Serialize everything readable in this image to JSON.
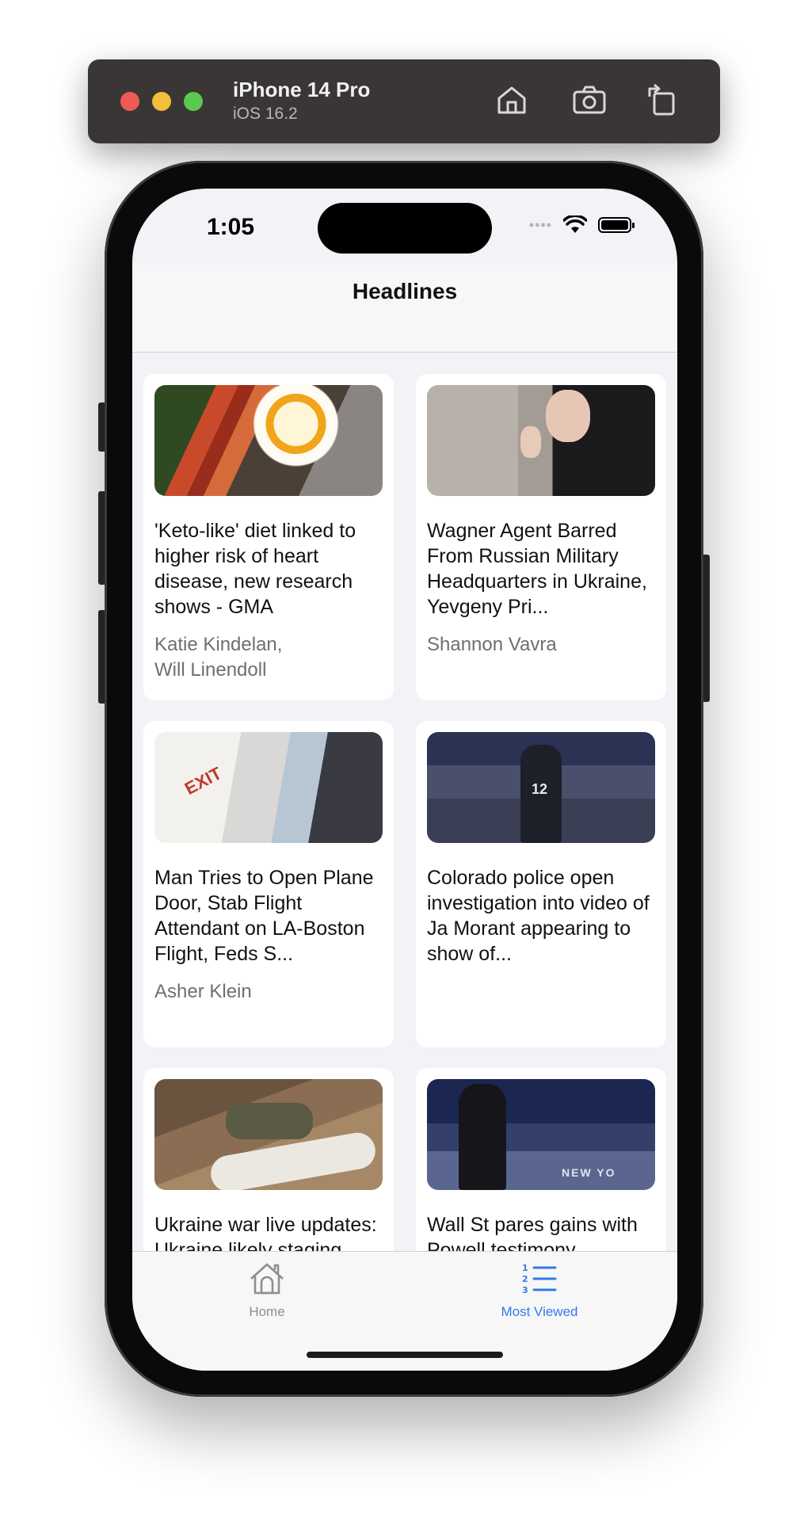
{
  "simulator": {
    "device_name": "iPhone 14 Pro",
    "os_version": "iOS 16.2",
    "buttons": [
      "home-icon",
      "screenshot-icon",
      "rotate-icon"
    ]
  },
  "status_bar": {
    "time": "1:05",
    "signal": "••••",
    "icons": [
      "signal-icon",
      "wifi-icon",
      "battery-icon"
    ]
  },
  "nav": {
    "title": "Headlines"
  },
  "articles": [
    {
      "title": "'Keto-like' diet linked to higher risk of heart disease, new research shows - GMA",
      "author": "Katie Kindelan,\nWill Linendoll",
      "image": "food-photo"
    },
    {
      "title": "Wagner Agent Barred From Russian Military Headquarters in Ukraine, Yevgeny Pri...",
      "author": "Shannon Vavra",
      "image": "politician-photo"
    },
    {
      "title": "Man Tries to Open Plane Door, Stab Flight Attendant on LA-Boston Flight, Feds S...",
      "author": "Asher Klein",
      "image": "airplane-exit-photo",
      "image_text": "EXIT"
    },
    {
      "title": "Colorado police open investigation into video of Ja Morant appearing to show of...",
      "author": "",
      "image": "basketball-photo",
      "image_text": "12"
    },
    {
      "title": "Ukraine war live updates: Ukraine likely staging 'tactical",
      "author": "",
      "image": "soldier-trench-photo"
    },
    {
      "title": "Wall St pares gains with Powell testimony, upcoming data in",
      "author": "",
      "image": "stock-exchange-photo",
      "image_text": "NEW YO"
    }
  ],
  "tab_bar": {
    "tabs": [
      {
        "label": "Home",
        "icon": "house-icon",
        "selected": false
      },
      {
        "label": "Most Viewed",
        "icon": "numbered-list-icon",
        "selected": true
      }
    ]
  },
  "colors": {
    "accent": "#2f7bea",
    "inactive": "#8e8e93",
    "background": "#f2f2f7",
    "card": "#ffffff",
    "author_text": "#6e6e73"
  }
}
